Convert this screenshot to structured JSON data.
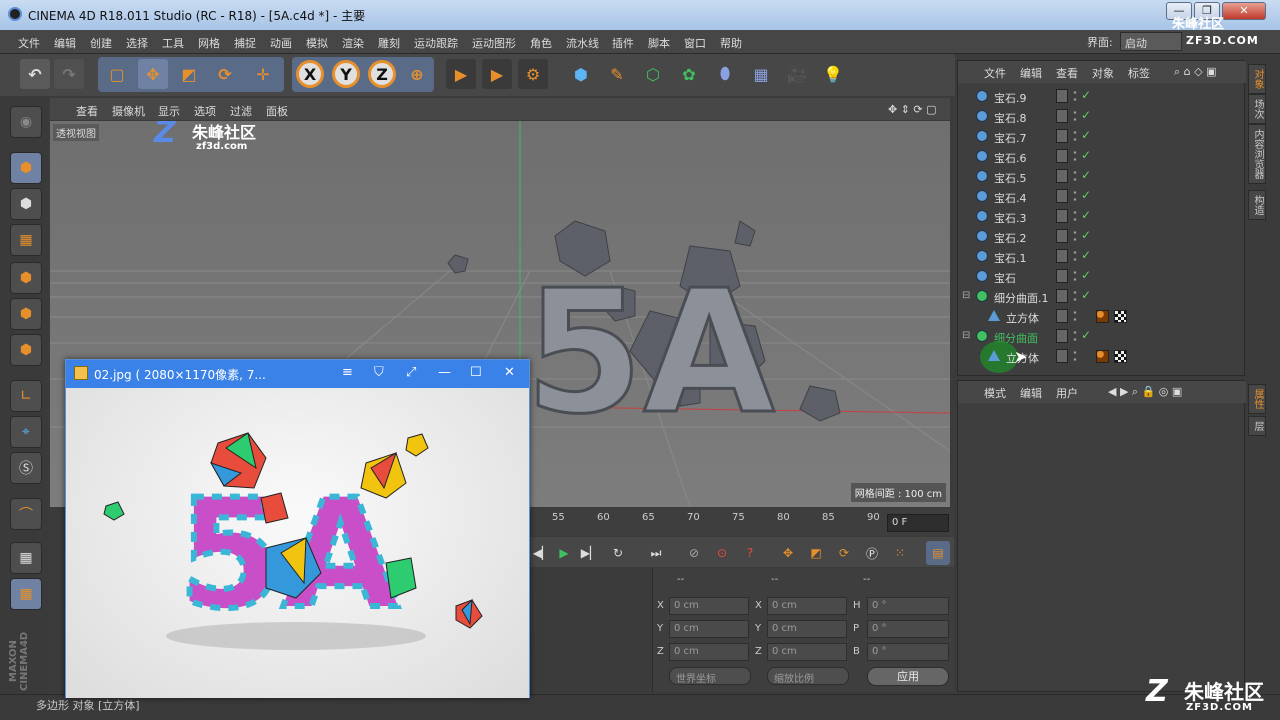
{
  "window": {
    "title": "CINEMA 4D R18.011 Studio (RC - R18) - [5A.c4d *] - 主要",
    "buttons": [
      "—",
      "❐",
      "✕"
    ]
  },
  "menu": {
    "items": [
      "文件",
      "编辑",
      "创建",
      "选择",
      "工具",
      "网格",
      "捕捉",
      "动画",
      "模拟",
      "渲染",
      "雕刻",
      "运动跟踪",
      "运动图形",
      "角色",
      "流水线",
      "插件",
      "脚本",
      "窗口",
      "帮助"
    ],
    "layout_label": "界面:",
    "layout_value": "启动"
  },
  "viewport": {
    "menu": [
      "查看",
      "摄像机",
      "显示",
      "选项",
      "过滤",
      "面板"
    ],
    "camera_label": "透视视图",
    "grid_info": "网格间距 : 100 cm",
    "model_text": "5A"
  },
  "timeline": {
    "ticks": [
      "55",
      "60",
      "65",
      "70",
      "75",
      "80",
      "85",
      "90"
    ],
    "frame": "0 F"
  },
  "coords": {
    "headers": [
      "--",
      "--",
      "--"
    ],
    "rows": [
      {
        "l1": "X",
        "v1": "0 cm",
        "l2": "X",
        "v2": "0 cm",
        "l3": "H",
        "v3": "0 °"
      },
      {
        "l1": "Y",
        "v1": "0 cm",
        "l2": "Y",
        "v2": "0 cm",
        "l3": "P",
        "v3": "0 °"
      },
      {
        "l1": "Z",
        "v1": "0 cm",
        "l2": "Z",
        "v2": "0 cm",
        "l3": "B",
        "v3": "0 °"
      }
    ],
    "dropdown_world": "世界坐标",
    "dropdown_scale": "缩放比例",
    "apply": "应用"
  },
  "object_manager": {
    "menu": [
      "文件",
      "编辑",
      "查看",
      "对象",
      "标签"
    ],
    "objects": [
      "宝石.9",
      "宝石.8",
      "宝石.7",
      "宝石.6",
      "宝石.5",
      "宝石.4",
      "宝石.3",
      "宝石.2",
      "宝石.1",
      "宝石",
      "细分曲面.1",
      "立方体",
      "细分曲面",
      "立方体"
    ]
  },
  "attribute_manager": {
    "menu": [
      "模式",
      "编辑",
      "用户"
    ]
  },
  "side_tabs": [
    "对象",
    "场次",
    "内容浏览器",
    "构造"
  ],
  "side_tabs_bottom": [
    "属性",
    "层"
  ],
  "status_bar": "多边形 对象 [立方体]",
  "image_viewer": {
    "title": "02.jpg ( 2080×1170像素, 7...",
    "buttons": [
      "≡",
      "⛉",
      "⤢",
      "—",
      "☐",
      "✕"
    ],
    "image_text": "5A"
  },
  "watermarks": {
    "viewport_name": "朱峰社区",
    "viewport_url": "zf3d.com",
    "corner_name": "朱峰社区",
    "corner_url": "ZF3D.COM",
    "top_name": "朱峰社区",
    "top_url": "ZF3D.COM"
  },
  "colors": {
    "accent": "#e7902b",
    "active_blue": "#3b82e8",
    "check_green": "#5fd35f"
  }
}
